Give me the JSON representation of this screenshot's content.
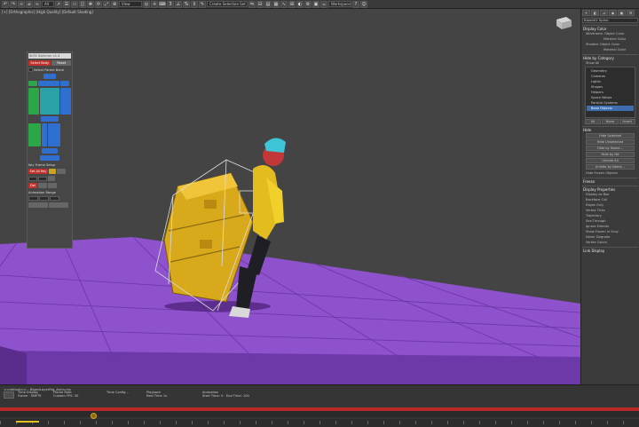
{
  "toolbar": {
    "selection_set": "Create Selection Set",
    "ref_coord": "View",
    "pivot": "",
    "mode": "Workspaces"
  },
  "viewport": {
    "label": "[+] [Orthographic] [High Quality] [Default Shading]"
  },
  "float_panel": {
    "title": "IK-FK Switcher v1.4",
    "btn_select_body": "Select Body",
    "btn_reset": "Reset",
    "chk_label": "Select Parent Bone",
    "key_section": "Key Frame Setup",
    "anim_range": "Animation Range",
    "btn_set_key": "Set All Key",
    "btn_delete": "Del"
  },
  "command_panel": {
    "object_name": "Biped01 Spine",
    "display_color": "Display Color",
    "wireframe_label": "Wireframe:",
    "object_color": "Object Color",
    "material_color": "Material Color",
    "shaded_label": "Shaded:",
    "hide_by_category": "Hide by Category",
    "show_all": "Show All",
    "category_items": [
      "Geometry",
      "Cameras",
      "Lights",
      "Shapes",
      "Helpers",
      "Space Warps",
      "Particle Systems",
      "Bone Objects"
    ],
    "btn_all": "All",
    "btn_none": "None",
    "btn_invert": "Invert",
    "hide": "Hide",
    "hide_selected": "Hide Selected",
    "hide_unselected": "Hide Unselected",
    "hide_by_name": "Hide by Name...",
    "hide_by_hit": "Hide by Hit",
    "unhide_all": "Unhide All",
    "unhide_by_name": "Unhide by Name...",
    "hide_frozen": "Hide Frozen Objects",
    "freeze": "Freeze",
    "display_properties": "Display Properties",
    "prop_items": [
      "Display as Box",
      "Backface Cull",
      "Edges Only",
      "Vertex Ticks",
      "Trajectory",
      "See-Through",
      "Ignore Extents",
      "Show Frozen in Gray",
      "Never Degrade",
      "Vertex Colors"
    ],
    "link_display": "Link Display"
  },
  "bottom": {
    "track_label": "<<default>> - BipedLayerRig_Anim.ms",
    "time_display": "Time Display",
    "frame": "Frame",
    "smpte": "SMPTE",
    "frame_rate": "Frame Rate",
    "custom": "Custom",
    "fps_label": "FPS:",
    "fps": "30",
    "time_config": "Time Config...",
    "playback": "Playback",
    "real_time": "Real Time",
    "speed": "1x",
    "animation": "Animation",
    "start_time": "Start Time:",
    "start": "0",
    "end_time": "End Time:",
    "end": "100"
  },
  "colors": {
    "floor": "#8a4fc8",
    "accent_red": "#b92a26",
    "character_yellow": "#d9a91c"
  }
}
